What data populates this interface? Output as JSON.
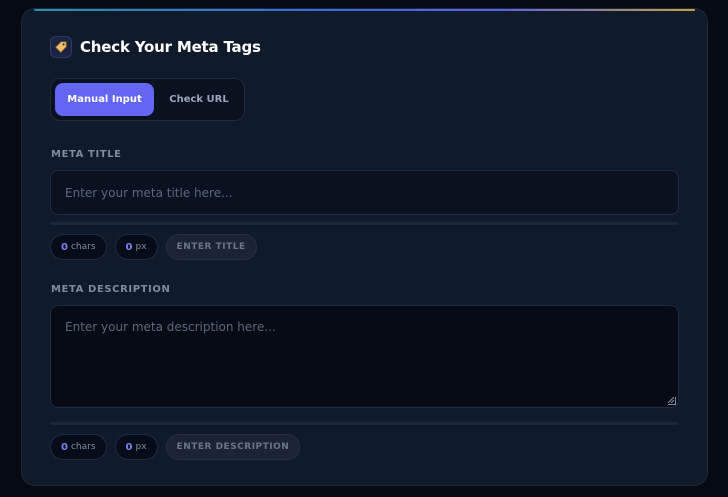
{
  "header": {
    "title": "Check Your Meta Tags",
    "icon": "tag-icon"
  },
  "mode_toggle": {
    "manual_label": "Manual Input",
    "url_label": "Check URL",
    "active": "manual"
  },
  "meta_title": {
    "label": "META TITLE",
    "placeholder": "Enter your meta title here...",
    "value": "",
    "chars_value": "0",
    "chars_unit": "chars",
    "px_value": "0",
    "px_unit": "px",
    "status": "ENTER TITLE"
  },
  "meta_description": {
    "label": "META DESCRIPTION",
    "placeholder": "Enter your meta description here...",
    "value": "",
    "chars_value": "0",
    "chars_unit": "chars",
    "px_value": "0",
    "px_unit": "px",
    "status": "ENTER DESCRIPTION"
  },
  "colors": {
    "accent": "#6366f1",
    "card_background": "#0f1a2b",
    "page_background": "#060a12"
  }
}
